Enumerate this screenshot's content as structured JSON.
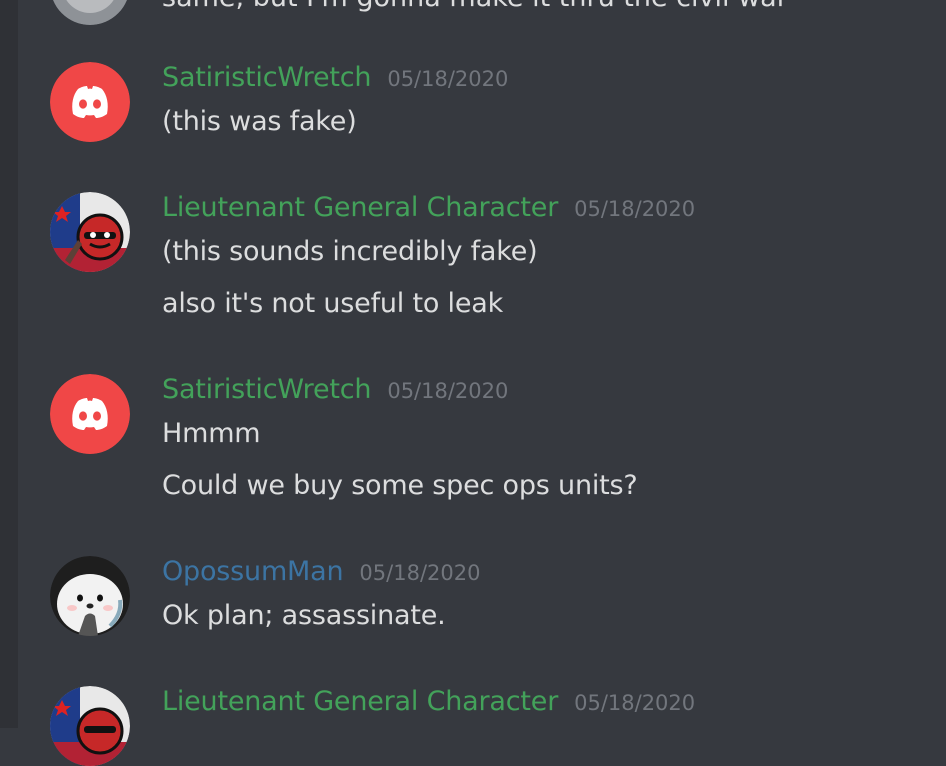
{
  "colors": {
    "background": "#36393f",
    "text": "#dcddde",
    "timestamp": "#72767d",
    "username_green": "#43a25a",
    "username_blue": "#3c74a3",
    "discord_red": "#f04747"
  },
  "top_partial_text": "same, but I'm gonna make it thru the civil war",
  "messages": [
    {
      "username": "SatiristicWretch",
      "timestamp": "05/18/2020",
      "avatar": "discord-default-red-icon",
      "lines": [
        "(this was fake)"
      ]
    },
    {
      "username": "Lieutenant General Character",
      "timestamp": "05/18/2020",
      "avatar": "flag-character-avatar",
      "lines": [
        "(this sounds incredibly fake)",
        "also it's not useful to leak"
      ]
    },
    {
      "username": "SatiristicWretch",
      "timestamp": "05/18/2020",
      "avatar": "discord-default-red-icon",
      "lines": [
        "Hmmm",
        "Could we buy some spec ops units?"
      ]
    },
    {
      "username": "OpossumMan",
      "timestamp": "05/18/2020",
      "avatar": "seal-character-avatar",
      "lines": [
        "Ok plan; assassinate."
      ]
    },
    {
      "username": "Lieutenant General Character",
      "timestamp": "05/18/2020",
      "avatar": "flag-character-avatar",
      "lines": []
    }
  ]
}
